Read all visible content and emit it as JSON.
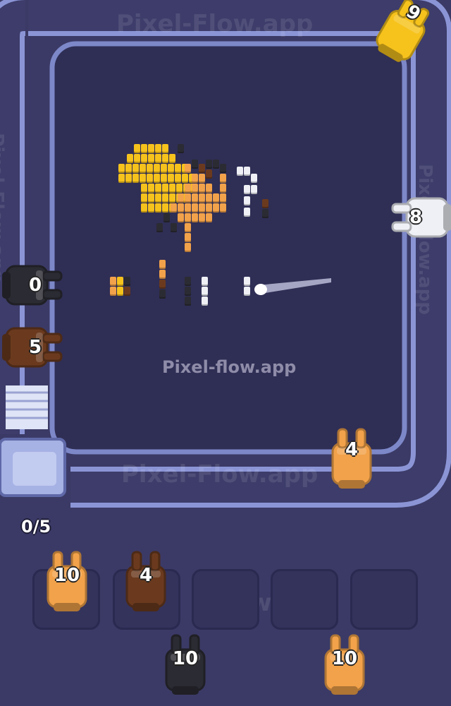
{
  "watermarks": {
    "top": "Pixel-Flow.app",
    "bottom": "Pixel-Flow.app",
    "left": "Pixel-Flow.app",
    "right": "Pixel-Flow.app",
    "slots": "Flow.app",
    "center": "Pixel-flow.app"
  },
  "progress": {
    "text": "0/5",
    "done": 0,
    "total": 5
  },
  "conveyor_units": [
    {
      "id": "yellow",
      "count": "9",
      "color": "#f6c21c"
    },
    {
      "id": "white",
      "count": "8",
      "color": "#eef0f6"
    },
    {
      "id": "black",
      "count": "0",
      "color": "#2b2b33"
    },
    {
      "id": "brown",
      "count": "5",
      "color": "#6b3a1e"
    },
    {
      "id": "orange",
      "count": "4",
      "color": "#f2a24a"
    }
  ],
  "slot_units": [
    {
      "id": "orange-slot",
      "count": "10",
      "color": "#f2a24a"
    },
    {
      "id": "brown-slot",
      "count": "4",
      "color": "#6b3a1e"
    }
  ],
  "empty_slots": 3,
  "queue_units": [
    {
      "id": "black-queue",
      "count": "10",
      "color": "#2b2b33"
    },
    {
      "id": "orange-queue",
      "count": "10",
      "color": "#f2a24a"
    }
  ],
  "palette": {
    "background": "#3b3a66",
    "track": "#7b86c9",
    "track_inner": "#3e3d6b",
    "yellow": "#f6c21c",
    "orange": "#f2a24a",
    "brown": "#6b3a1e",
    "black": "#2b2b33",
    "white": "#eef0f6"
  }
}
